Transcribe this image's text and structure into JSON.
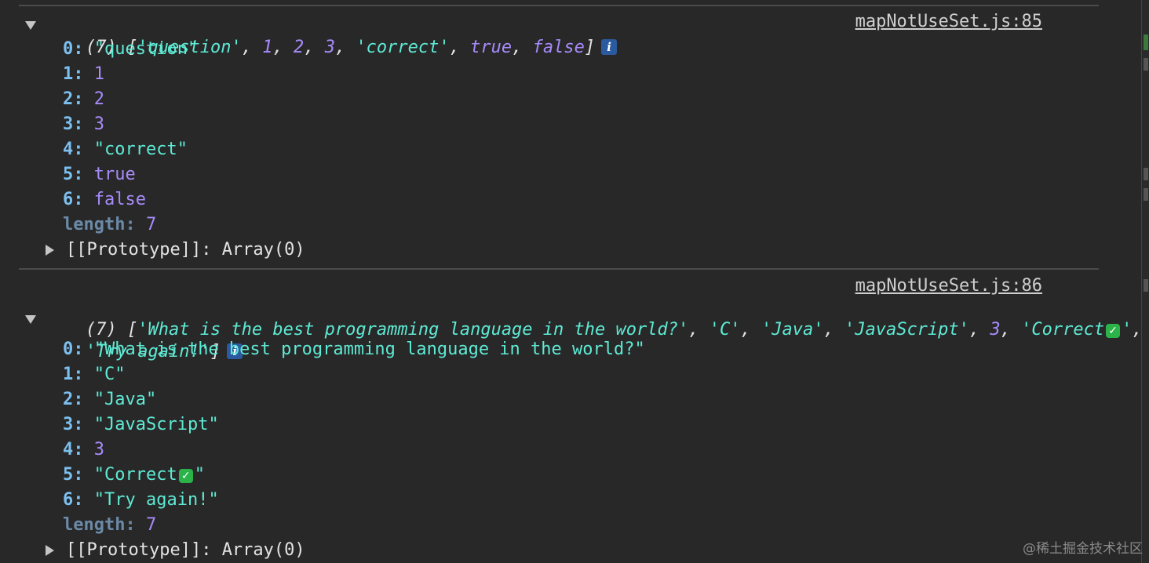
{
  "log1": {
    "source": "mapNotUseSet.js:85",
    "count": "(7)",
    "preview": {
      "s0": "'question'",
      "n1": "1",
      "n2": "2",
      "n3": "3",
      "s4": "'correct'",
      "b5": "true",
      "b6": "false"
    },
    "items": [
      {
        "key": "0",
        "value": "\"question\""
      },
      {
        "key": "1",
        "value": "1"
      },
      {
        "key": "2",
        "value": "2"
      },
      {
        "key": "3",
        "value": "3"
      },
      {
        "key": "4",
        "value": "\"correct\""
      },
      {
        "key": "5",
        "value": "true"
      },
      {
        "key": "6",
        "value": "false"
      }
    ],
    "length_label": "length",
    "length_value": "7",
    "prototype_label": "[[Prototype]]",
    "prototype_value": "Array(0)"
  },
  "log2": {
    "source": "mapNotUseSet.js:86",
    "count": "(7)",
    "preview": {
      "s0": "'What is the best programming language in the world?'",
      "s1": "'C'",
      "s2": "'Java'",
      "s3": "'JavaScript'",
      "n4": "3",
      "s5": "'Correct",
      "s5_end": "'",
      "s6": "'Try again!'"
    },
    "items": [
      {
        "key": "0",
        "value": "\"What is the best programming language in the world?\""
      },
      {
        "key": "1",
        "value": "\"C\""
      },
      {
        "key": "2",
        "value": "\"Java\""
      },
      {
        "key": "3",
        "value": "\"JavaScript\""
      },
      {
        "key": "4",
        "value": "3"
      },
      {
        "key": "5",
        "value": "\"Correct",
        "value_end": "\""
      },
      {
        "key": "6",
        "value": "\"Try again!\""
      }
    ],
    "length_label": "length",
    "length_value": "7",
    "prototype_label": "[[Prototype]]",
    "prototype_value": "Array(0)"
  },
  "icons": {
    "info": "i",
    "check": "✓"
  },
  "watermark": "@稀土掘金技术社区",
  "colors": {
    "background": "#282828",
    "string": "#5eead4",
    "number": "#a78bfa",
    "key": "#7cc0f0",
    "info_badge": "#2b5aa0",
    "check_emoji": "#2bb34a"
  }
}
